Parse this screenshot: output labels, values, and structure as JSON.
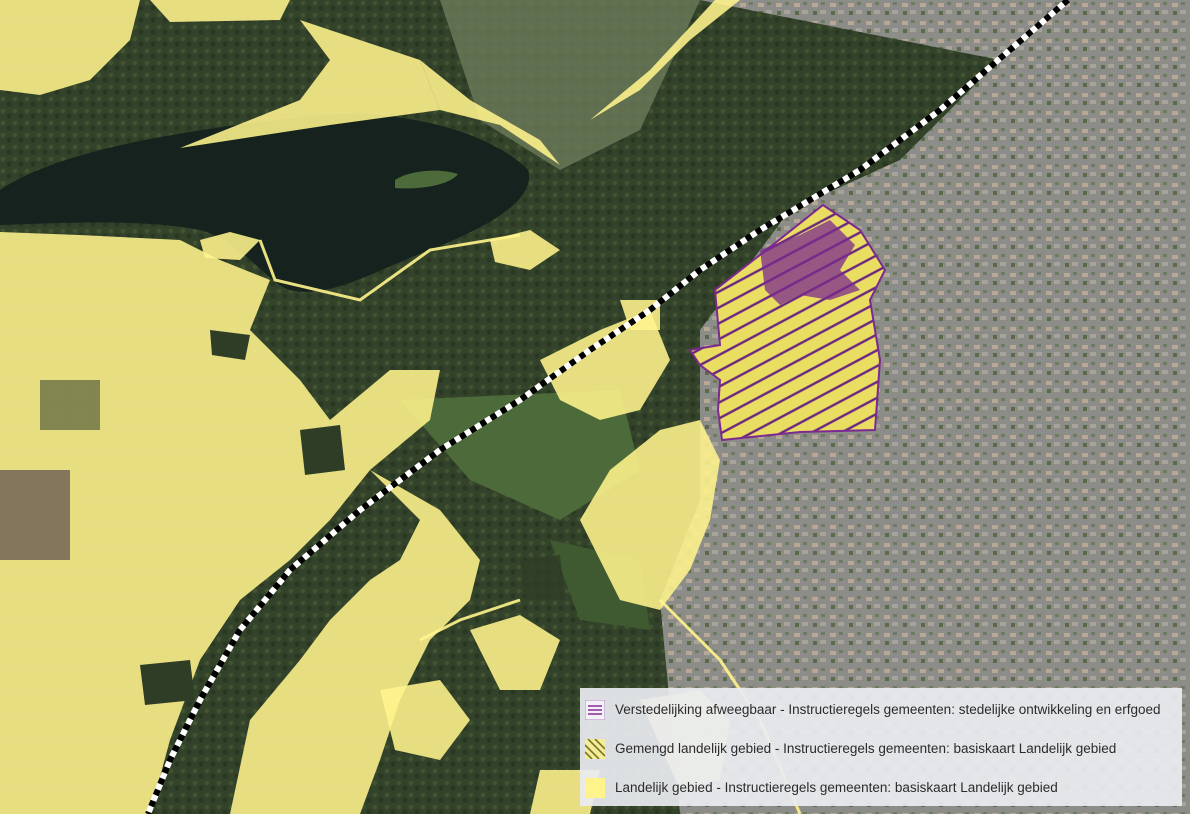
{
  "colors": {
    "landelijk": "#fff48c",
    "verstedelijking": "#8a2b96",
    "gemengd": "#d8cf4e",
    "railway": "#000000"
  },
  "legend": {
    "items": [
      {
        "label": "Verstedelijking afweegbaar - Instructieregels gemeenten: stedelijke ontwikkeling en erfgoed",
        "swatch": "purple-horizontal-lines-icon"
      },
      {
        "label": "Gemengd landelijk gebied - Instructieregels gemeenten: basiskaart Landelijk gebied",
        "swatch": "yellow-diagonal-hatch-icon"
      },
      {
        "label": "Landelijk gebied - Instructieregels gemeenten: basiskaart Landelijk gebied",
        "swatch": "yellow-fill-icon"
      }
    ]
  }
}
